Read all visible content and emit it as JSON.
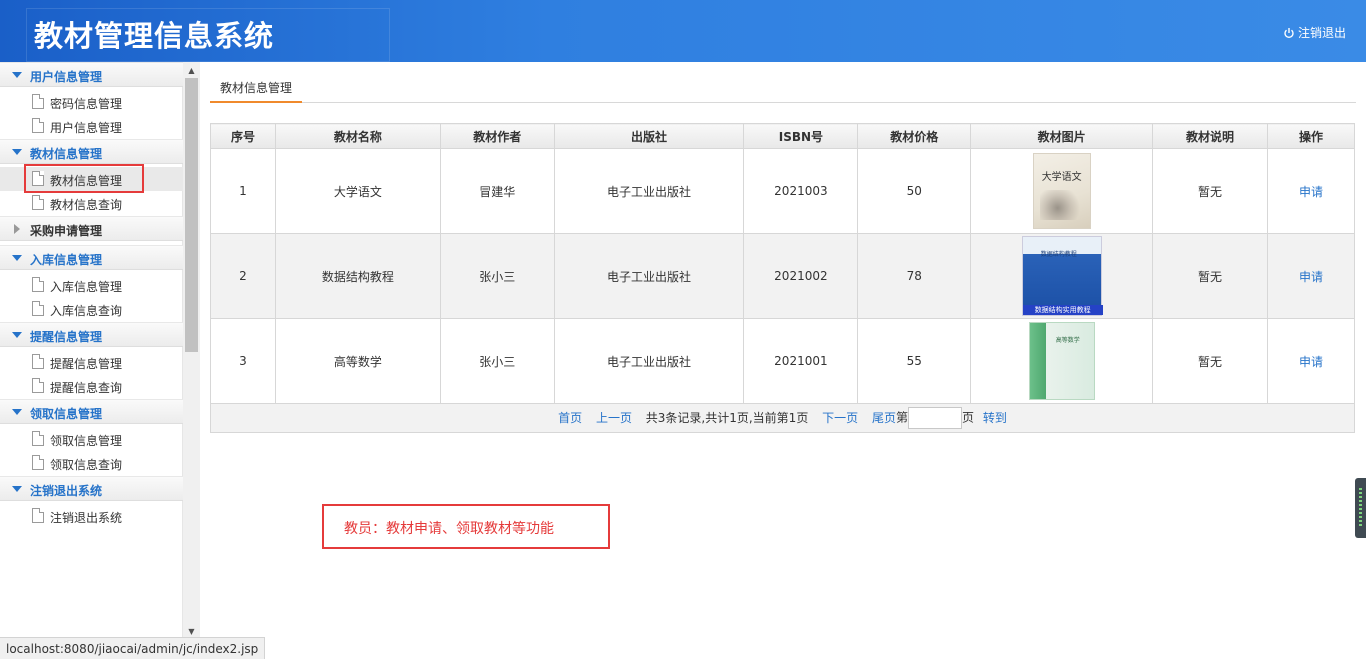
{
  "header": {
    "title": "教材管理信息系统",
    "logout_label": "注销退出"
  },
  "sidebar": {
    "groups": [
      {
        "label": "用户信息管理",
        "items": [
          "密码信息管理",
          "用户信息管理"
        ]
      },
      {
        "label": "教材信息管理",
        "items": [
          "教材信息管理",
          "教材信息查询"
        ]
      },
      {
        "label": "采购申请管理",
        "items": []
      },
      {
        "label": "入库信息管理",
        "items": [
          "入库信息管理",
          "入库信息查询"
        ]
      },
      {
        "label": "提醒信息管理",
        "items": [
          "提醒信息管理",
          "提醒信息查询"
        ]
      },
      {
        "label": "领取信息管理",
        "items": [
          "领取信息管理",
          "领取信息查询"
        ]
      },
      {
        "label": "注销退出系统",
        "items": [
          "注销退出系统"
        ]
      }
    ]
  },
  "main": {
    "tab": "教材信息管理",
    "columns": [
      "序号",
      "教材名称",
      "教材作者",
      "出版社",
      "ISBN号",
      "教材价格",
      "教材图片",
      "教材说明",
      "操作"
    ],
    "rows": [
      {
        "no": "1",
        "name": "大学语文",
        "author": "冒建华",
        "publisher": "电子工业出版社",
        "isbn": "2021003",
        "price": "50",
        "note": "暂无",
        "action": "申请",
        "cover_title": "大学语文"
      },
      {
        "no": "2",
        "name": "数据结构教程",
        "author": "张小三",
        "publisher": "电子工业出版社",
        "isbn": "2021002",
        "price": "78",
        "note": "暂无",
        "action": "申请",
        "cover_title": "数据结构教程",
        "cover_bottom": "数据结构实用教程"
      },
      {
        "no": "3",
        "name": "高等数学",
        "author": "张小三",
        "publisher": "电子工业出版社",
        "isbn": "2021001",
        "price": "55",
        "note": "暂无",
        "action": "申请",
        "cover_title": "高等数学"
      }
    ],
    "pager": {
      "first": "首页",
      "prev": "上一页",
      "summary": "共3条记录,共计1页,当前第1页",
      "next": "下一页",
      "last": "尾页",
      "page_prefix": "第",
      "page_suffix": "页",
      "go": "转到",
      "page_input": ""
    }
  },
  "annotation": "教员：教材申请、领取教材等功能",
  "status_bar": "localhost:8080/jiaocai/admin/jc/index2.jsp",
  "colors": {
    "header": "#2f7fe0",
    "accent": "#2673c9",
    "annotation": "#e53b3b",
    "tab_underline": "#f08a2c"
  }
}
